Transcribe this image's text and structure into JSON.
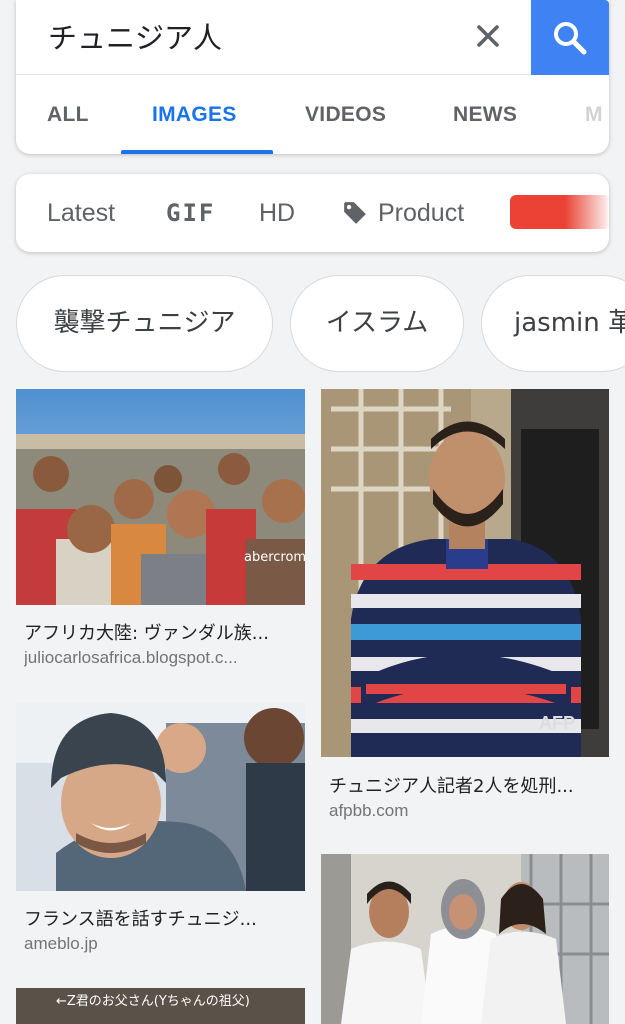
{
  "search": {
    "query": "チュニジア人"
  },
  "tabs": [
    {
      "label": "ALL"
    },
    {
      "label": "IMAGES"
    },
    {
      "label": "VIDEOS"
    },
    {
      "label": "NEWS"
    },
    {
      "label": "M"
    }
  ],
  "filters": {
    "latest": "Latest",
    "gif": "GIF",
    "hd": "HD",
    "product": "Product",
    "color_swatch": "#ea4335"
  },
  "chips": [
    {
      "label": "襲撃チュニジア"
    },
    {
      "label": "イスラム"
    },
    {
      "label": "jasmin 革"
    }
  ],
  "results": [
    {
      "title": "アフリカ大陸: ヴァンダル族...",
      "source": "juliocarlosafrica.blogspot.c...",
      "image_text": "abercromb"
    },
    {
      "title": "チュニジア人記者2人を処刑...",
      "source": "afpbb.com",
      "image_text": "AFP"
    },
    {
      "title": "フランス語を話すチュニジ...",
      "source": "ameblo.jp"
    },
    {
      "title": "",
      "source": "",
      "image_text": "←Z君のお父さん(Yちゃんの祖父)"
    },
    {
      "title": "",
      "source": ""
    }
  ],
  "colors": {
    "accent": "#1a73e8",
    "search_button": "#3f82f4",
    "background": "#f1f3f4"
  }
}
